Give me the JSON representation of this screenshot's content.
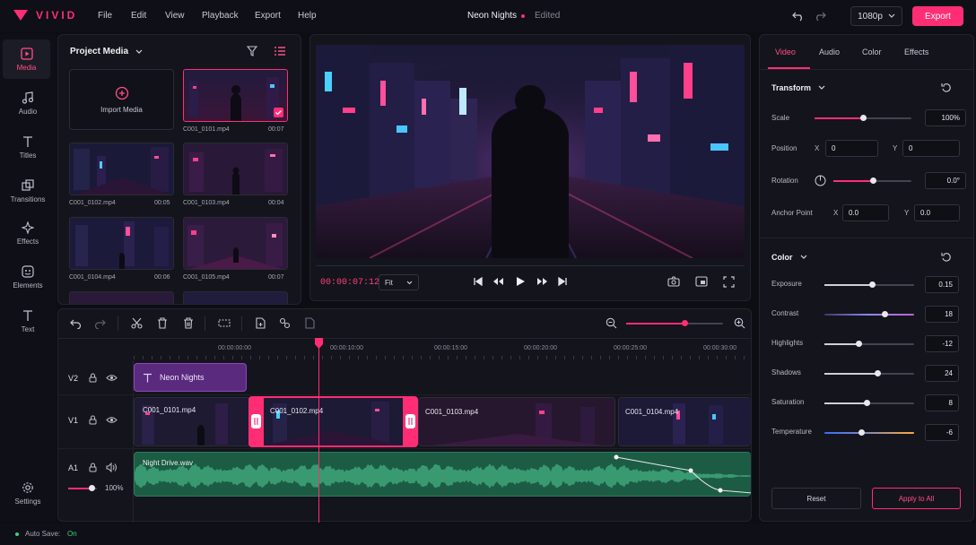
{
  "app": {
    "name": "VIVID",
    "menu": [
      "File",
      "Edit",
      "View",
      "Playback",
      "Export",
      "Help"
    ],
    "project": "Neon Nights",
    "project_status": "Edited",
    "resolution": "1080p",
    "export_label": "Export"
  },
  "sidebar": {
    "items": [
      {
        "label": "Media",
        "icon": "media-icon"
      },
      {
        "label": "Audio",
        "icon": "music-note-icon"
      },
      {
        "label": "Titles",
        "icon": "text-t-icon"
      },
      {
        "label": "Transitions",
        "icon": "transitions-icon"
      },
      {
        "label": "Effects",
        "icon": "sparkle-icon"
      },
      {
        "label": "Elements",
        "icon": "elements-icon"
      },
      {
        "label": "Text",
        "icon": "text-t-icon"
      }
    ],
    "settings": "Settings"
  },
  "media": {
    "title": "Project Media",
    "import_label": "Import Media",
    "items": [
      {
        "name": "C001_0101.mp4",
        "dur": "00:07",
        "selected": true
      },
      {
        "name": "C001_0102.mp4",
        "dur": "00:05"
      },
      {
        "name": "C001_0103.mp4",
        "dur": "00:04"
      },
      {
        "name": "C001_0104.mp4",
        "dur": "00:06"
      },
      {
        "name": "C001_0105.mp4",
        "dur": "00:07"
      }
    ]
  },
  "preview": {
    "timecode": "00:00:07:12",
    "fit": "Fit"
  },
  "timeline": {
    "ruler": [
      "00:00:00:00",
      "00:00:10:00",
      "00:00:15:00",
      "00:00:20:00",
      "00:00:25:00",
      "00:00:30:00"
    ],
    "zoom": 0.6,
    "tracks": {
      "v2": "V2",
      "v1": "V1",
      "a1": "A1"
    },
    "title_clip": "Neon Nights",
    "clips": [
      "C001_0101.mp4",
      "C001_0102.mp4",
      "C001_0103.mp4",
      "C001_0104.mp4"
    ],
    "audio_clip": "Night Drive.wav",
    "volume": "100%",
    "volume_level": 0.8
  },
  "props": {
    "tabs": [
      "Video",
      "Audio",
      "Color",
      "Effects"
    ],
    "transform_title": "Transform",
    "scale": {
      "label": "Scale",
      "value": "100%",
      "level": 0.5
    },
    "position": {
      "label": "Position",
      "x_label": "X",
      "x": "0",
      "y_label": "Y",
      "y": "0"
    },
    "rotation": {
      "label": "Rotation",
      "value": "0.0°",
      "level": 0.5
    },
    "anchor": {
      "label": "Anchor Point",
      "x_label": "X",
      "x": "0.0",
      "y_label": "Y",
      "y": "0.0"
    },
    "color_title": "Color",
    "color": [
      {
        "label": "Exposure",
        "value": "0.15",
        "level": 0.53
      },
      {
        "label": "Contrast",
        "value": "18",
        "level": 0.67
      },
      {
        "label": "Highlights",
        "value": "-12",
        "level": 0.38
      },
      {
        "label": "Shadows",
        "value": "24",
        "level": 0.59
      },
      {
        "label": "Saturation",
        "value": "8",
        "level": 0.47
      },
      {
        "label": "Temperature",
        "value": "-6",
        "level": 0.41
      }
    ],
    "reset": "Reset",
    "apply": "Apply to All"
  },
  "status": {
    "label": "Auto Save:",
    "value": "On"
  },
  "colors": {
    "accent": "#ff2e74",
    "panel": "#14141c",
    "audio": "#1f6b4e"
  }
}
